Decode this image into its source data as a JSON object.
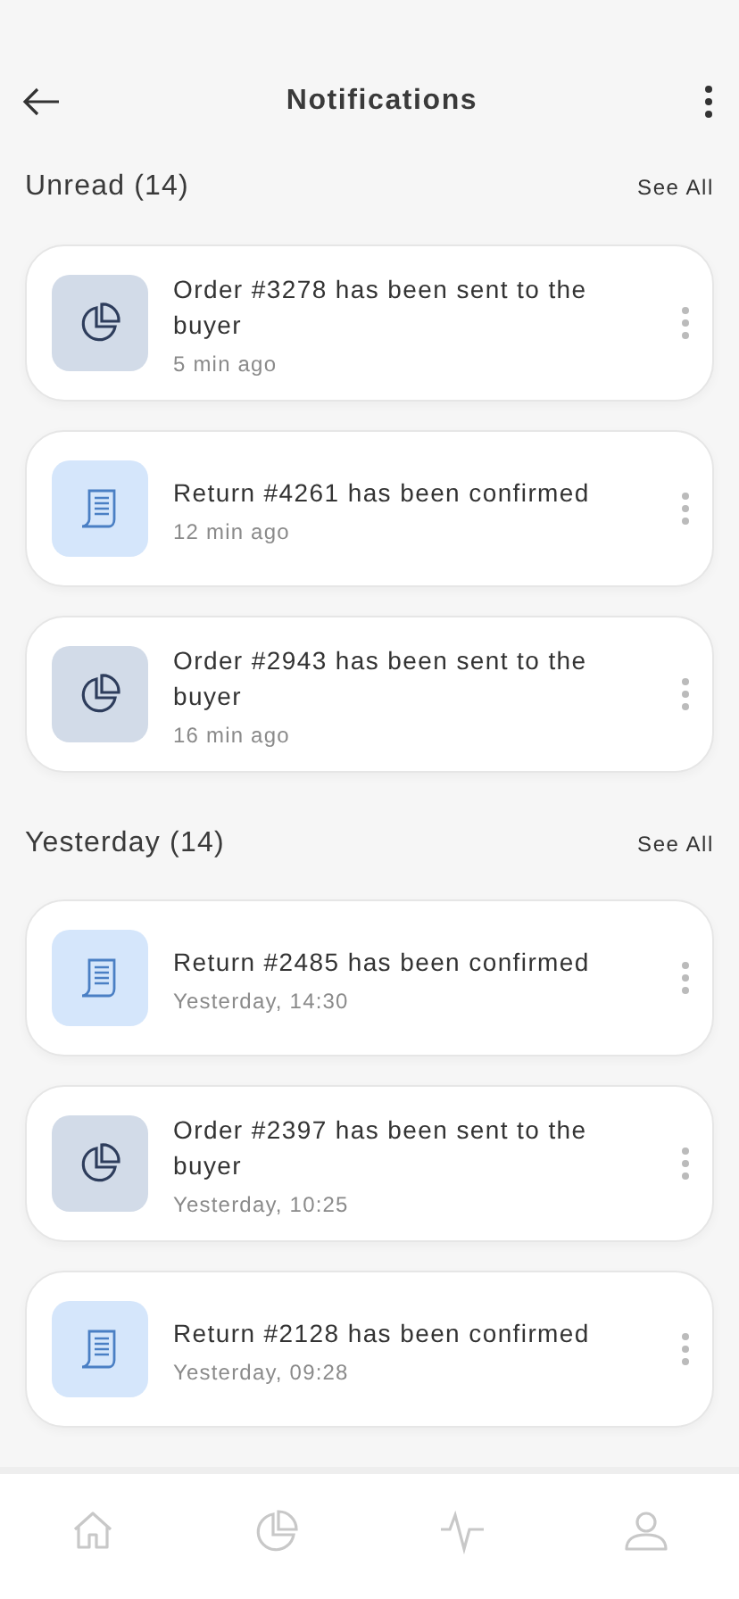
{
  "header": {
    "title": "Notifications"
  },
  "sections": [
    {
      "title": "Unread (14)",
      "action": "See All",
      "items": [
        {
          "kind": "order",
          "text": "Order #3278 has been sent to the buyer",
          "time": "5 min ago"
        },
        {
          "kind": "return",
          "text": "Return #4261 has been confirmed",
          "time": "12 min ago"
        },
        {
          "kind": "order",
          "text": "Order #2943 has been sent to the buyer",
          "time": "16 min ago"
        }
      ]
    },
    {
      "title": "Yesterday (14)",
      "action": "See All",
      "items": [
        {
          "kind": "return",
          "text": "Return #2485 has been confirmed",
          "time": "Yesterday, 14:30"
        },
        {
          "kind": "order",
          "text": "Order #2397 has been sent to the buyer",
          "time": "Yesterday, 10:25"
        },
        {
          "kind": "return",
          "text": "Return #2128 has been confirmed",
          "time": "Yesterday, 09:28"
        }
      ]
    }
  ]
}
